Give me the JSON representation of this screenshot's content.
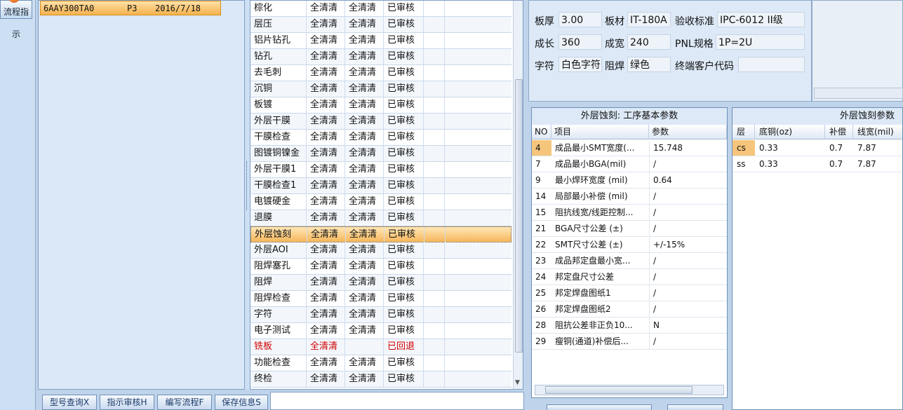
{
  "left_nav": {
    "flow_label": "流程指示"
  },
  "model_list": {
    "selected": {
      "model": "6AAY300TA0",
      "version": "P3",
      "date": "2016/7/18"
    }
  },
  "process_table": {
    "rows": [
      {
        "step": "棕化",
        "a": "全清清",
        "b": "全清清",
        "status": "已审核"
      },
      {
        "step": "层压",
        "a": "全清清",
        "b": "全清清",
        "status": "已审核"
      },
      {
        "step": "铝片钻孔",
        "a": "全清清",
        "b": "全清清",
        "status": "已审核"
      },
      {
        "step": "钻孔",
        "a": "全清清",
        "b": "全清清",
        "status": "已审核"
      },
      {
        "step": "去毛刺",
        "a": "全清清",
        "b": "全清清",
        "status": "已审核"
      },
      {
        "step": "沉铜",
        "a": "全清清",
        "b": "全清清",
        "status": "已审核"
      },
      {
        "step": "板镀",
        "a": "全清清",
        "b": "全清清",
        "status": "已审核"
      },
      {
        "step": "外层干膜",
        "a": "全清清",
        "b": "全清清",
        "status": "已审核"
      },
      {
        "step": "干膜检查",
        "a": "全清清",
        "b": "全清清",
        "status": "已审核"
      },
      {
        "step": "图镀铜镍金",
        "a": "全清清",
        "b": "全清清",
        "status": "已审核"
      },
      {
        "step": "外层干膜1",
        "a": "全清清",
        "b": "全清清",
        "status": "已审核"
      },
      {
        "step": "干膜检查1",
        "a": "全清清",
        "b": "全清清",
        "status": "已审核"
      },
      {
        "step": "电镀硬金",
        "a": "全清清",
        "b": "全清清",
        "status": "已审核"
      },
      {
        "step": "退膜",
        "a": "全清清",
        "b": "全清清",
        "status": "已审核"
      },
      {
        "step": "外层蚀刻",
        "a": "全清清",
        "b": "全清清",
        "status": "已审核"
      },
      {
        "step": "外层AOI",
        "a": "全清清",
        "b": "全清清",
        "status": "已审核"
      },
      {
        "step": "阻焊塞孔",
        "a": "全清清",
        "b": "全清清",
        "status": "已审核"
      },
      {
        "step": "阻焊",
        "a": "全清清",
        "b": "全清清",
        "status": "已审核"
      },
      {
        "step": "阻焊检查",
        "a": "全清清",
        "b": "全清清",
        "status": "已审核"
      },
      {
        "step": "字符",
        "a": "全清清",
        "b": "全清清",
        "status": "已审核"
      },
      {
        "step": "电子测试",
        "a": "全清清",
        "b": "全清清",
        "status": "已审核"
      },
      {
        "step": "铣板",
        "a": "全清清",
        "b": "",
        "status": "已回退"
      },
      {
        "step": "功能检查",
        "a": "全清清",
        "b": "全清清",
        "status": "已审核"
      },
      {
        "step": "终检",
        "a": "全清清",
        "b": "全清清",
        "status": "已审核"
      }
    ],
    "selected_step": "外层蚀刻",
    "returned_step": "铣板"
  },
  "bottom_buttons": {
    "model_query": "型号查询X",
    "instruction_review": "指示审核H",
    "write_flow": "编写流程F",
    "save_info": "保存信息S"
  },
  "board_info": {
    "thickness_label": "板厚",
    "thickness": "3.00",
    "material_label": "板材",
    "material": "IT-180A",
    "standard_label": "验收标准",
    "standard": "IPC-6012 II级",
    "length_label": "成长",
    "length": "360",
    "width_label": "成宽",
    "width": "240",
    "pnl_label": "PNL规格",
    "pnl": "1P=2U",
    "char_label": "字符",
    "char": "白色字符",
    "mask_label": "阻焊",
    "mask": "绿色",
    "customer_label": "终端客户代码",
    "customer": ""
  },
  "params_panel": {
    "title": "外层蚀刻: 工序基本参数",
    "headers": {
      "no": "NO",
      "item": "项目",
      "value": "参数"
    },
    "rows": [
      {
        "no": "4",
        "item": "成品最小SMT宽度(...",
        "value": "15.748"
      },
      {
        "no": "7",
        "item": "成品最小BGA(mil)",
        "value": "/"
      },
      {
        "no": "9",
        "item": "最小焊环宽度 (mil)",
        "value": "0.64"
      },
      {
        "no": "14",
        "item": "局部最小补偿 (mil)",
        "value": "/"
      },
      {
        "no": "15",
        "item": "阻抗线宽/线距控制...",
        "value": "/"
      },
      {
        "no": "21",
        "item": "BGA尺寸公差 (±)",
        "value": "/"
      },
      {
        "no": "22",
        "item": "SMT尺寸公差 (±)",
        "value": "+/-15%"
      },
      {
        "no": "23",
        "item": "成品邦定盘最小宽...",
        "value": "/"
      },
      {
        "no": "24",
        "item": "邦定盘尺寸公差",
        "value": "/"
      },
      {
        "no": "25",
        "item": "邦定焊盘图纸1",
        "value": "/"
      },
      {
        "no": "26",
        "item": "邦定焊盘图纸2",
        "value": "/"
      },
      {
        "no": "28",
        "item": "阻抗公差非正负10...",
        "value": "N"
      },
      {
        "no": "29",
        "item": "瘦铜(通道)补偿后...",
        "value": "/"
      }
    ]
  },
  "etch_panel": {
    "title": "外层蚀刻参数",
    "headers": {
      "layer": "层",
      "base_cu": "底铜(oz)",
      "comp": "补偿",
      "line_width": "线宽(mil)"
    },
    "rows": [
      {
        "layer": "cs",
        "base_cu": "0.33",
        "comp": "0.7",
        "line_width": "7.87"
      },
      {
        "layer": "ss",
        "base_cu": "0.33",
        "comp": "0.7",
        "line_width": "7.87"
      }
    ]
  },
  "colors": {
    "selection": "#f6b65a",
    "returned": "#d00000",
    "panel_bg": "#dde9f7"
  }
}
